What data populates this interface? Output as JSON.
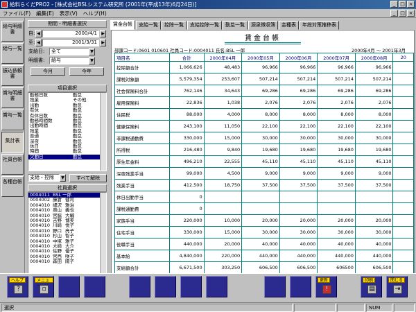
{
  "window": {
    "title": "給料らくだPRO2 - [株式会社BSLシステム研究所 (2001年(平成13年)6月24日)]",
    "min": "_",
    "max": "□",
    "close": "×"
  },
  "menu": [
    "ファイル(F)",
    "編集(E)",
    "表示(V)",
    "ヘルプ(H)"
  ],
  "nav": [
    "給与明細書",
    "給与一覧",
    "振込依頼書",
    "賞与明細書",
    "賞与一覧",
    "集計表",
    "社員台帳",
    "各種台帳"
  ],
  "period": {
    "header": "期間・明細書選択",
    "from_label": "自:",
    "from": "2000/4/1",
    "to_label": "至:",
    "to": "2001/3/31",
    "payday_label": "支給日:",
    "payday": "全て",
    "type_label": "明細書:",
    "type": "給与",
    "this_month": "今月",
    "this_year": "今年"
  },
  "items": {
    "header": "項目選択",
    "rows": [
      [
        "勤務日数",
        "勤怠"
      ],
      [
        "残業",
        "その他"
      ],
      [
        "出勤",
        "勤怠"
      ],
      [
        "有休",
        "勤怠"
      ],
      [
        "有休日数",
        "勤怠"
      ],
      [
        "勤務時間数",
        "勤怠"
      ],
      [
        "出勤時間",
        "勤怠"
      ],
      [
        "残業",
        "勤怠"
      ],
      [
        "普通",
        "勤怠"
      ],
      [
        "深夜",
        "勤怠"
      ],
      [
        "休日",
        "勤怠"
      ],
      [
        "時間",
        "勤怠"
      ],
      [
        "欠勤日",
        "勤怠"
      ]
    ],
    "filter": "支給・控除",
    "clear": "すべて解除"
  },
  "employees": {
    "header": "社員選択",
    "rows": [
      [
        "0004011",
        "BSL 一郎"
      ],
      [
        "0004002",
        "藤倉",
        "健司"
      ],
      [
        "0004010",
        "細沢",
        "雅治"
      ],
      [
        "0004010",
        "奥山",
        "義也"
      ],
      [
        "0004010",
        "宮脇",
        "大輔"
      ],
      [
        "0004010",
        "吉野",
        "博美"
      ],
      [
        "0004010",
        "川崎",
        "悦子"
      ],
      [
        "0004010",
        "野口",
        "亮子"
      ],
      [
        "0004010",
        "杉山",
        "智子"
      ],
      [
        "0004010",
        "中塚",
        "雅子"
      ],
      [
        "0004010",
        "大崎",
        "大介"
      ],
      [
        "0004010",
        "佐野",
        "優子"
      ],
      [
        "0004010",
        "宮西",
        "咲子"
      ],
      [
        "0004010",
        "森田",
        "陽子"
      ]
    ]
  },
  "tabs": [
    "賃金台帳",
    "支給一覧",
    "控除一覧",
    "支給控除一覧",
    "勤怠一覧",
    "源泉徴収簿",
    "金種表",
    "年総対策推移表"
  ],
  "ledger": {
    "title": "賃金台帳",
    "dept": "部課コード:0601 010601",
    "emp_code": "社員コード:0004011",
    "emp_name": "氏名:BSL 一郎",
    "range": "2000年4月 〜 2001年3月",
    "columns": [
      "項目名",
      "合計",
      "2000年04月",
      "2000年05月",
      "2000年06月",
      "2000年07月",
      "2000年08月",
      "20"
    ],
    "rows": [
      [
        "控除額合計",
        "1,066,626",
        "48,483",
        "96,966",
        "96,966",
        "96,966",
        "96,966"
      ],
      [
        "課税対象額",
        "5,579,354",
        "253,607",
        "507,214",
        "507,214",
        "507,214",
        "507,214"
      ],
      [
        "社会保険料合計",
        "762,146",
        "34,643",
        "69,286",
        "69,286",
        "69,286",
        "69,286"
      ],
      [
        "雇用保険料",
        "22,836",
        "1,038",
        "2,076",
        "2,076",
        "2,076",
        "2,076"
      ],
      [
        "住民税",
        "88,000",
        "4,000",
        "8,000",
        "8,000",
        "8,000",
        "8,000"
      ],
      [
        "健康保険料",
        "243,100",
        "11,050",
        "22,100",
        "22,100",
        "22,100",
        "22,100"
      ],
      [
        "非課税通勤費",
        "330,000",
        "15,000",
        "30,000",
        "30,000",
        "30,000",
        "30,000"
      ],
      [
        "所得税",
        "216,480",
        "9,840",
        "19,680",
        "19,680",
        "19,680",
        "19,680"
      ],
      [
        "厚生年金料",
        "496,210",
        "22,555",
        "45,110",
        "45,110",
        "45,110",
        "45,110"
      ],
      [
        "深夜残業手当",
        "99,000",
        "4,500",
        "9,000",
        "9,000",
        "9,000",
        "9,000"
      ],
      [
        "残業手当",
        "412,500",
        "18,750",
        "37,500",
        "37,500",
        "37,500",
        "37,500"
      ],
      [
        "休日出勤手当",
        "0",
        "",
        "",
        "",
        "",
        ""
      ],
      [
        "課税通勤費",
        "0",
        "",
        "",
        "",
        "",
        ""
      ],
      [
        "家族手当",
        "220,000",
        "10,000",
        "20,000",
        "20,000",
        "20,000",
        "20,000"
      ],
      [
        "住宅手当",
        "330,000",
        "15,000",
        "30,000",
        "30,000",
        "30,000",
        "30,000"
      ],
      [
        "役職手当",
        "440,000",
        "20,000",
        "40,000",
        "40,000",
        "40,000",
        "40,000"
      ],
      [
        "基本給",
        "4,840,000",
        "220,000",
        "440,000",
        "440,000",
        "440,000",
        "440,000"
      ],
      [
        "支給額合計",
        "6,671,500",
        "303,250",
        "606,500",
        "606,500",
        "606500",
        "606,500"
      ]
    ]
  },
  "fkeys": {
    "help": "ヘルプ",
    "menu": "メニュー",
    "update": "更新",
    "print": "印刷",
    "close": "閉じる"
  },
  "status": {
    "left": "選択",
    "num": "NUM"
  }
}
